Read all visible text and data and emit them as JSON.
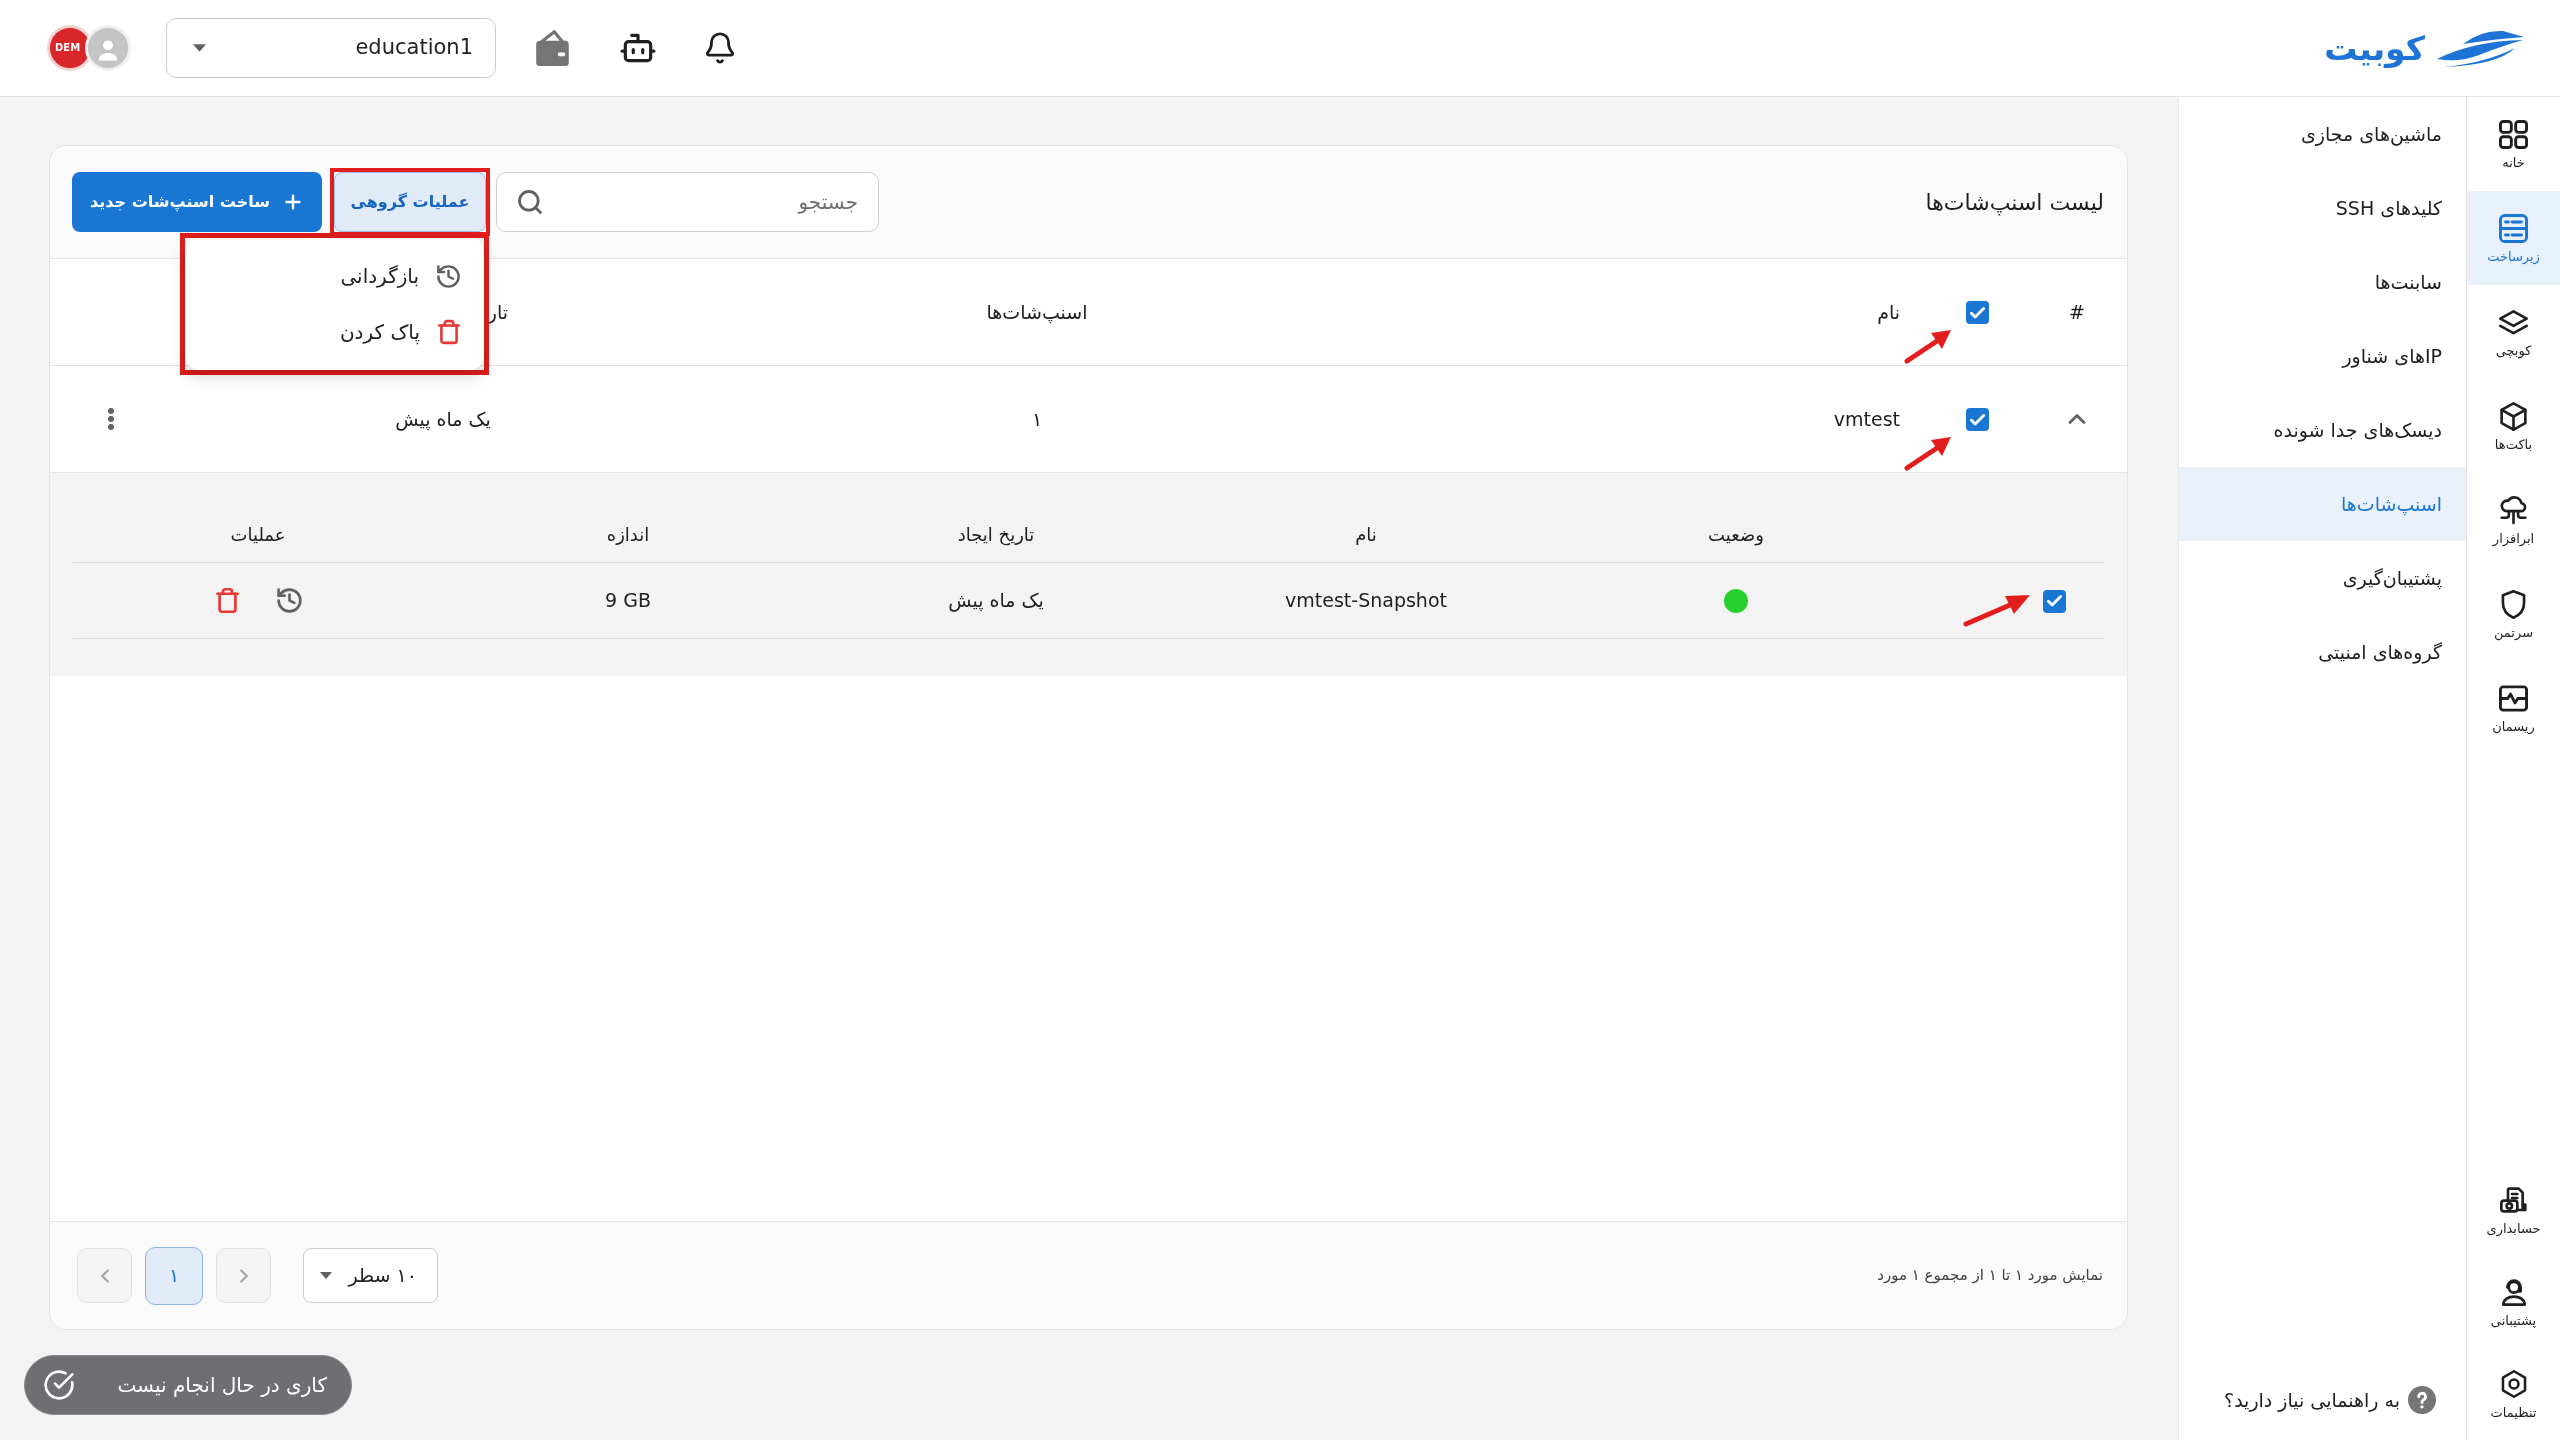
{
  "topbar": {
    "logo_text": "کوبیت",
    "workspace": {
      "value": "education1"
    },
    "demo_badge": "DEM"
  },
  "rail": {
    "items": [
      {
        "label": "خانه",
        "selected": false
      },
      {
        "label": "زیرساخت",
        "selected": true
      },
      {
        "label": "کوبچی",
        "selected": false
      },
      {
        "label": "باکت‌ها",
        "selected": false
      },
      {
        "label": "ابرافزار",
        "selected": false
      },
      {
        "label": "سرتمن",
        "selected": false
      },
      {
        "label": "ریسمان",
        "selected": false
      }
    ],
    "bottom_items": [
      {
        "label": "حسابداری",
        "selected": false
      },
      {
        "label": "پشتیبانی",
        "selected": false
      },
      {
        "label": "تنظیمات",
        "selected": false
      }
    ]
  },
  "sidebar": {
    "items": [
      {
        "label": "ماشین‌های مجازی",
        "selected": false
      },
      {
        "label": "کلیدهای SSH",
        "selected": false
      },
      {
        "label": "سابنت‌ها",
        "selected": false
      },
      {
        "label": "IPهای شناور",
        "selected": false
      },
      {
        "label": "دیسک‌های جدا شونده",
        "selected": false
      },
      {
        "label": "اسنپ‌شات‌ها",
        "selected": true
      },
      {
        "label": "پشتیبان‌گیری",
        "selected": false
      },
      {
        "label": "گروه‌های امنیتی",
        "selected": false
      }
    ],
    "help": "به راهنمایی نیاز دارید؟"
  },
  "snapshots": {
    "title": "لیست اسنپ‌شات‌ها",
    "search": {
      "placeholder": "جستجو"
    },
    "bulk_actions": {
      "label": "عملیات گروهی",
      "highlighted": true,
      "expanded": true,
      "menu": {
        "highlighted": true,
        "items": [
          {
            "kind": "restore",
            "label": "بازگردانی"
          },
          {
            "kind": "delete",
            "label": "پاک کردن"
          }
        ]
      }
    },
    "create_button": {
      "label": "ساخت اسنپ‌شات جدید"
    },
    "table": {
      "columns": [
        "#",
        "نام",
        "اسنپ‌شات‌ها",
        "تار"
      ],
      "select_all": {
        "checked": true,
        "arrow": true
      },
      "rows": [
        {
          "expanded": true,
          "checked": true,
          "arrow": true,
          "name": "vmtest",
          "count": "۱",
          "created": "یک ماه پیش",
          "snapshots": {
            "columns": [
              "وضعیت",
              "نام",
              "تاریخ ایجاد",
              "اندازه",
              "عملیات"
            ],
            "rows": [
              {
                "checked": true,
                "arrow": true,
                "color": "#26d12f",
                "name": "vmtest-Snapshot",
                "created": "یک ماه پیش",
                "size": "9 GB"
              }
            ]
          }
        }
      ]
    },
    "pagination": {
      "summary": "نمایش مورد ۱ تا ۱ از مجموع ۱ مورد",
      "page_size": "۱۰ سطر",
      "previous": {
        "disabled": true
      },
      "pages": [
        {
          "label": "۱",
          "selected": true
        }
      ],
      "next": {
        "disabled": true
      }
    }
  },
  "toast": {
    "label": "کاری در حال انجام نیست"
  }
}
